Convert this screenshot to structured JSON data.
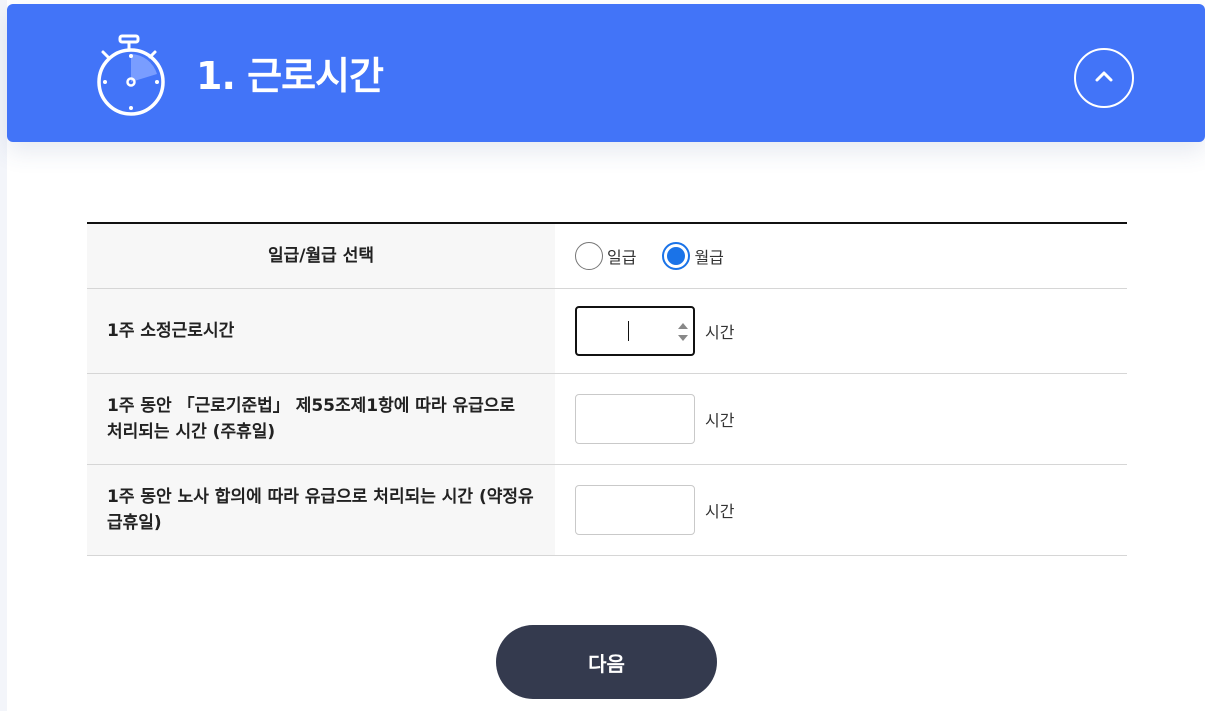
{
  "header": {
    "title": "1. 근로시간",
    "icon": "stopwatch-icon",
    "collapse_icon": "chevron-up-icon",
    "color": "#4274f8"
  },
  "form": {
    "pay_type": {
      "label": "일급/월급 선택",
      "options": [
        {
          "label": "일급",
          "checked": false
        },
        {
          "label": "월급",
          "checked": true
        }
      ]
    },
    "weekly_hours": {
      "label": "1주 소정근로시간",
      "value": "",
      "unit": "시간"
    },
    "weekly_holiday": {
      "label": "1주 동안 「근로기준법」 제55조제1항에 따라 유급으로 처리되는 시간 (주휴일)",
      "value": "",
      "unit": "시간"
    },
    "agreed_holiday": {
      "label": "1주 동안 노사 합의에 따라 유급으로 처리되는 시간 (약정유급휴일)",
      "value": "",
      "unit": "시간"
    }
  },
  "next_button": {
    "label": "다음",
    "color": "#343a4e"
  }
}
